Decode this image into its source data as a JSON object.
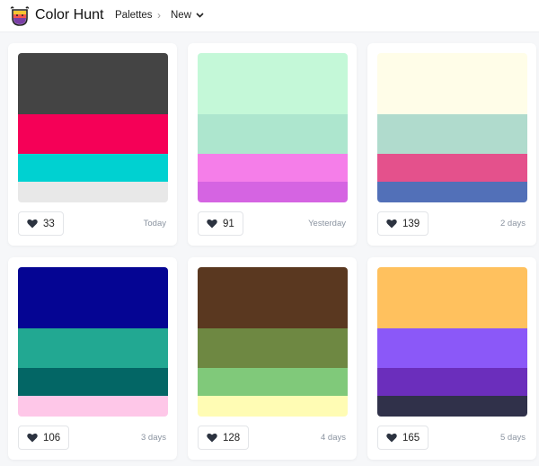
{
  "header": {
    "brand": "Color Hunt",
    "breadcrumb": {
      "palettes": "Palettes",
      "separator": "›",
      "current": "New"
    }
  },
  "palettes": [
    {
      "colors": [
        "#444444",
        "#f50057",
        "#00d1d1",
        "#e8e8e8"
      ],
      "likes": "33",
      "date": "Today"
    },
    {
      "colors": [
        "#c4f8d8",
        "#ade6ce",
        "#f57ee9",
        "#d564e2"
      ],
      "likes": "91",
      "date": "Yesterday"
    },
    {
      "colors": [
        "#fffde8",
        "#b0dbcd",
        "#e4518c",
        "#5270b8"
      ],
      "likes": "139",
      "date": "2 days"
    },
    {
      "colors": [
        "#050593",
        "#22a892",
        "#036665",
        "#fec7e8"
      ],
      "likes": "106",
      "date": "3 days"
    },
    {
      "colors": [
        "#5a3820",
        "#6e8842",
        "#80c97a",
        "#fffcb4"
      ],
      "likes": "128",
      "date": "4 days"
    },
    {
      "colors": [
        "#ffc15e",
        "#8b58f8",
        "#6b2ebc",
        "#30314a"
      ],
      "likes": "165",
      "date": "5 days"
    }
  ]
}
